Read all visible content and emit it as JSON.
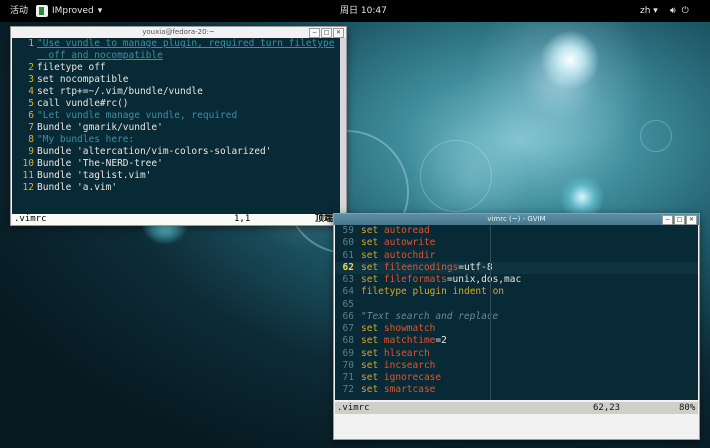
{
  "colors": {
    "top_bar": "#000000",
    "editor_bg": "#072a36",
    "line_number": "#e3b022",
    "keyword": "#d6a62a",
    "option": "#e5532c",
    "comment": "#6b8a8e",
    "gvim_title": "#5d8fa4"
  },
  "top_bar": {
    "activities": "活动",
    "app_name": "IMproved",
    "app_arrow": "▾",
    "clock": "周日 10:47",
    "lang": "zh ▾",
    "tray_icons": [
      "volume-icon",
      "power-icon"
    ]
  },
  "terminal": {
    "title": "youxia@fedora-20:~",
    "buttons": [
      "−",
      "□",
      "✕"
    ],
    "lines": [
      {
        "num": "1",
        "text": "\"Use vundle to manage plugin, required turn filetype"
      },
      {
        "num": "",
        "text": "  off and nocompatible"
      },
      {
        "num": "2",
        "text": "filetype off"
      },
      {
        "num": "3",
        "text": "set nocompatible"
      },
      {
        "num": "4",
        "text": "set rtp+=~/.vim/bundle/vundle"
      },
      {
        "num": "5",
        "text": "call vundle#rc()"
      },
      {
        "num": "6",
        "text": "\"Let vundle manage vundle, required"
      },
      {
        "num": "7",
        "text": "Bundle 'gmarik/vundle'"
      },
      {
        "num": "8",
        "text": "\"My bundles here:"
      },
      {
        "num": "9",
        "text": "Bundle 'altercation/vim-colors-solarized'"
      },
      {
        "num": "10",
        "text": "Bundle 'The-NERD-tree'"
      },
      {
        "num": "11",
        "text": "Bundle 'taglist.vim'"
      },
      {
        "num": "12",
        "text": "Bundle 'a.vim'"
      }
    ],
    "status_file": ".vimrc",
    "status_pos": "1,1",
    "status_scroll": "顶端"
  },
  "gvim": {
    "title": "vimrc (~) - GVIM",
    "buttons": [
      "−",
      "□",
      "✕"
    ],
    "lines": [
      {
        "num": "59",
        "cmd": "set",
        "opt": "autoread",
        "rest": "",
        "type": "set"
      },
      {
        "num": "60",
        "cmd": "set",
        "opt": "autowrite",
        "rest": "",
        "type": "set"
      },
      {
        "num": "61",
        "cmd": "set",
        "opt": "autochdir",
        "rest": "",
        "type": "set"
      },
      {
        "num": "62",
        "cmd": "set",
        "opt": "fileencodings",
        "rest": "=utf-8",
        "type": "set",
        "current": true
      },
      {
        "num": "63",
        "cmd": "set",
        "opt": "fileformats",
        "rest": "=unix,dos,mac",
        "type": "set"
      },
      {
        "num": "64",
        "cmd": "filetype",
        "opt": "plugin indent on",
        "rest": "",
        "type": "set"
      },
      {
        "num": "65",
        "cmd": "",
        "opt": "",
        "rest": "",
        "type": "blank"
      },
      {
        "num": "66",
        "cmd": "",
        "opt": "",
        "rest": "\"Text search and replace",
        "type": "comment"
      },
      {
        "num": "67",
        "cmd": "set",
        "opt": "showmatch",
        "rest": "",
        "type": "set"
      },
      {
        "num": "68",
        "cmd": "set",
        "opt": "matchtime",
        "rest": "=2",
        "type": "set"
      },
      {
        "num": "69",
        "cmd": "set",
        "opt": "hlsearch",
        "rest": "",
        "type": "set"
      },
      {
        "num": "70",
        "cmd": "set",
        "opt": "incsearch",
        "rest": "",
        "type": "set"
      },
      {
        "num": "71",
        "cmd": "set",
        "opt": "ignorecase",
        "rest": "",
        "type": "set"
      },
      {
        "num": "72",
        "cmd": "set",
        "opt": "smartcase",
        "rest": "",
        "type": "set"
      }
    ],
    "status_file": ".vimrc",
    "status_pos": "62,23",
    "status_scroll": "80%"
  }
}
